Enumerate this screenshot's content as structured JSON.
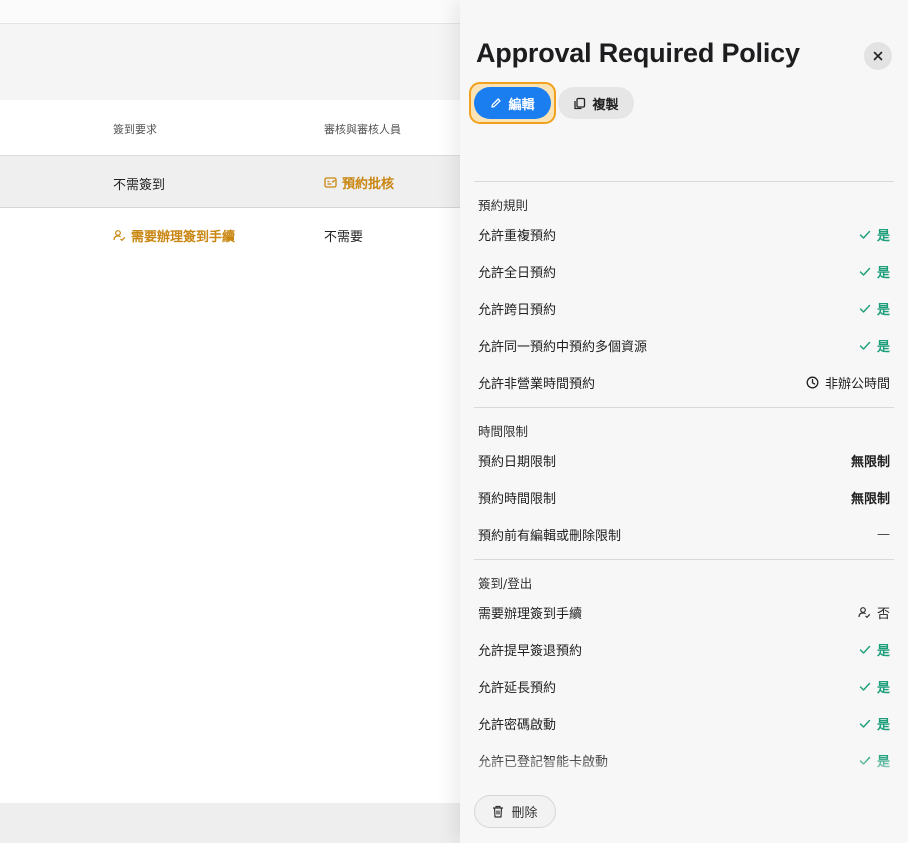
{
  "background": {
    "columns": [
      "簽到要求",
      "審核與審核人員"
    ],
    "rows": [
      {
        "checkin": "不需簽到",
        "approval": "預約批核"
      },
      {
        "checkin": "需要辦理簽到手續",
        "approval": "不需要"
      }
    ]
  },
  "drawer": {
    "title": "Approval Required Policy",
    "close_icon": "close-icon",
    "edit_label": "編輯",
    "copy_label": "複製",
    "delete_label": "刪除",
    "sections": [
      {
        "title": "預約規則",
        "rows": [
          {
            "label": "允許重複預約",
            "value": "是",
            "kind": "yes"
          },
          {
            "label": "允許全日預約",
            "value": "是",
            "kind": "yes"
          },
          {
            "label": "允許跨日預約",
            "value": "是",
            "kind": "yes"
          },
          {
            "label": "允許同一預約中預約多個資源",
            "value": "是",
            "kind": "yes"
          },
          {
            "label": "允許非營業時間預約",
            "value": "非辦公時間",
            "kind": "clock"
          }
        ]
      },
      {
        "title": "時間限制",
        "rows": [
          {
            "label": "預約日期限制",
            "value": "無限制",
            "kind": "bold"
          },
          {
            "label": "預約時間限制",
            "value": "無限制",
            "kind": "bold"
          },
          {
            "label": "預約前有編輯或刪除限制",
            "value": "—",
            "kind": "dash"
          }
        ]
      },
      {
        "title": "簽到/登出",
        "rows": [
          {
            "label": "需要辦理簽到手續",
            "value": "否",
            "kind": "person"
          },
          {
            "label": "允許提早簽退預約",
            "value": "是",
            "kind": "yes"
          },
          {
            "label": "允許延長預約",
            "value": "是",
            "kind": "yes"
          },
          {
            "label": "允許密碼啟動",
            "value": "是",
            "kind": "yes"
          },
          {
            "label": "允許已登記智能卡啟動",
            "value": "是",
            "kind": "yes"
          }
        ]
      }
    ]
  },
  "colors": {
    "accent": "#1a7ef0",
    "yes": "#1b9e7a",
    "warning": "#c98610",
    "focus": "#f2a11e"
  }
}
